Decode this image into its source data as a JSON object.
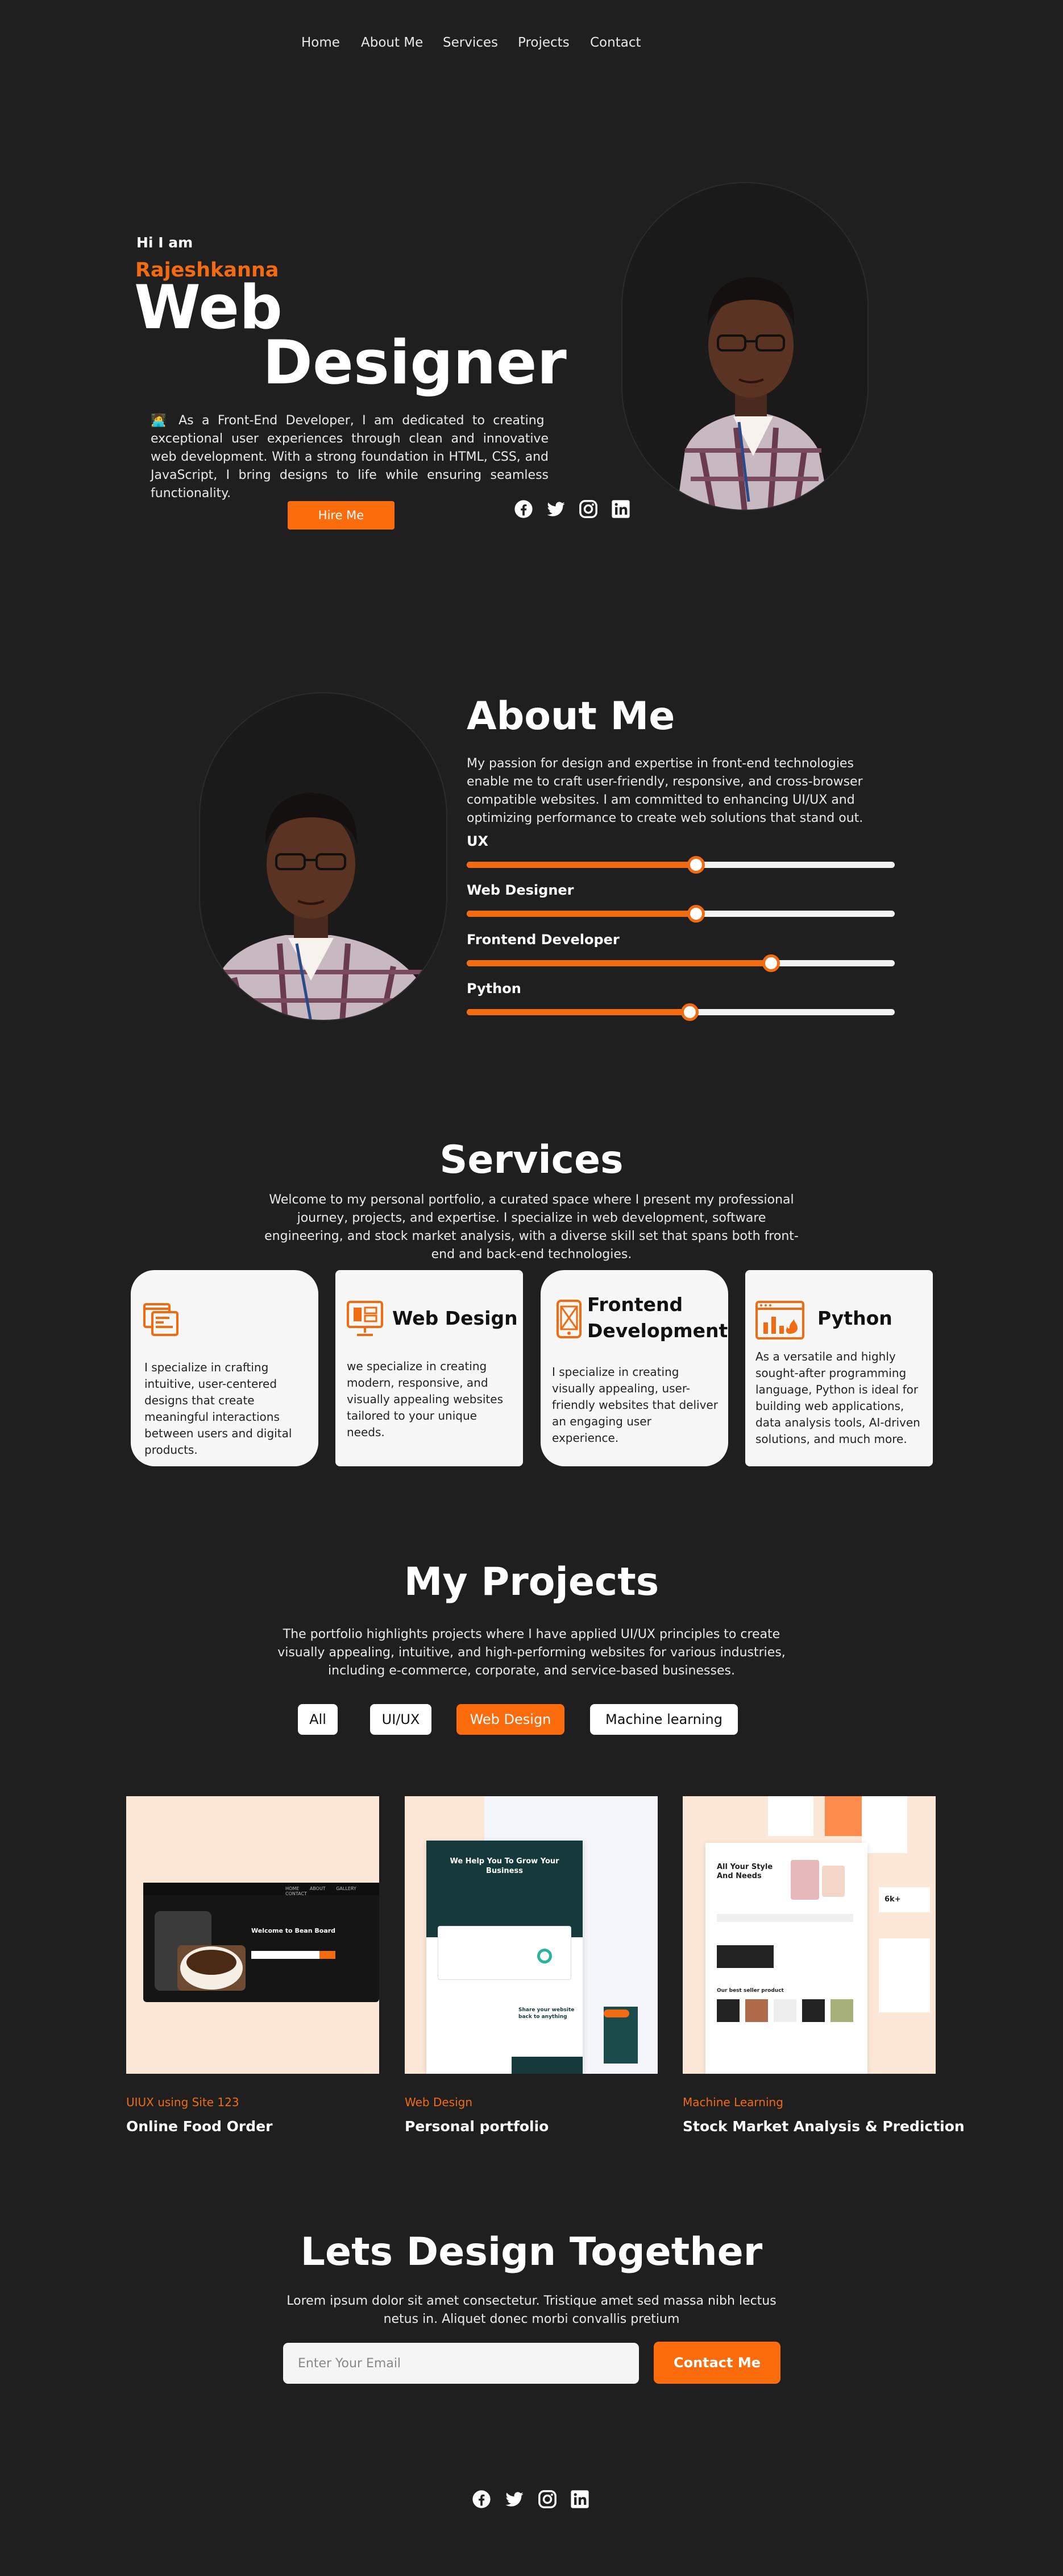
{
  "nav": {
    "items": [
      "Home",
      "About Me",
      "Services",
      "Projects",
      "Contact"
    ]
  },
  "hero": {
    "greeting": "Hi I am",
    "name": "Rajeshkanna",
    "title_line1": "Web",
    "title_line2": "Designer",
    "description": "🧑‍💻 As a Front-End Developer, I am dedicated to creating exceptional user experiences through clean and innovative web development. With a strong foundation in HTML, CSS, and JavaScript, I bring designs to life while ensuring seamless functionality.",
    "button": "Hire Me",
    "socials": [
      "facebook-icon",
      "twitter-icon",
      "instagram-icon",
      "linkedin-icon"
    ]
  },
  "about": {
    "title": "About Me",
    "description": "My passion for design and expertise in front-end technologies enable me to craft user-friendly, responsive, and cross-browser compatible websites. I am committed to enhancing UI/UX and optimizing performance to create web solutions that stand out.",
    "skills": [
      {
        "label": "UX",
        "level": 0.535
      },
      {
        "label": "Web Designer",
        "level": 0.535
      },
      {
        "label": "Frontend Developer",
        "level": 0.71
      },
      {
        "label": "Python",
        "level": 0.52
      }
    ]
  },
  "services": {
    "title": "Services",
    "description": "Welcome to my personal portfolio, a curated space where I present my professional journey, projects, and expertise. I specialize in web development, software engineering, and stock market analysis, with a diverse skill set that spans both front-end and back-end technologies.",
    "cards": [
      {
        "icon": "ui-layout-icon",
        "title": "",
        "text": "I specialize in crafting intuitive, user-centered designs that create meaningful interactions between users and digital products."
      },
      {
        "icon": "web-design-icon",
        "title": "Web Design",
        "text": "we specialize in creating modern, responsive, and visually appealing websites tailored to your unique needs."
      },
      {
        "icon": "mobile-frontend-icon",
        "title": "Frontend Development",
        "text": "I specialize in creating visually appealing, user-friendly websites that deliver an engaging user experience."
      },
      {
        "icon": "python-analytics-icon",
        "title": "Python",
        "text": "As a versatile and highly sought-after programming language, Python is ideal for building web applications, data analysis tools, AI-driven solutions, and much more."
      }
    ]
  },
  "projects": {
    "title": "My Projects",
    "description": "The portfolio highlights projects where I have applied UI/UX principles to create visually appealing, intuitive, and high-performing websites for various industries, including e-commerce, corporate, and service-based businesses.",
    "filters": [
      "All",
      "UI/UX",
      "Web Design",
      "Machine learning"
    ],
    "active_filter": "Web Design",
    "items": [
      {
        "category": "UIUX using Site 123",
        "title": "Online Food Order",
        "mock_heading": "Welcome to Bean Board",
        "mock_nav": [
          "HOME",
          "ABOUT",
          "GALLERY",
          "CONTACT"
        ]
      },
      {
        "category": "Web Design",
        "title": "Personal portfolio",
        "mock_heading": "We Help You To Grow Your Business",
        "mock_lower": "Share your website back to anything"
      },
      {
        "category": "Machine  Learning",
        "title": "Stock Market Analysis & Prediction",
        "mock_heading": "All Your Style And Needs",
        "mock_lower": "Our best seller product",
        "mock_stat": "6k+"
      }
    ]
  },
  "contact": {
    "title": "Lets Design Together",
    "description": "Lorem ipsum dolor sit amet consectetur. Tristique amet sed massa nibh lectus netus in. Aliquet donec morbi convallis pretium",
    "email_placeholder": "Enter Your Email",
    "button": "Contact Me"
  },
  "footer": {
    "socials": [
      "facebook-icon",
      "twitter-icon",
      "instagram-icon",
      "linkedin-icon"
    ]
  },
  "colors": {
    "accent": "#f26b11",
    "background": "#1f1f1f",
    "card": "#f7f7f7",
    "project_bg": "#fde8d8"
  }
}
